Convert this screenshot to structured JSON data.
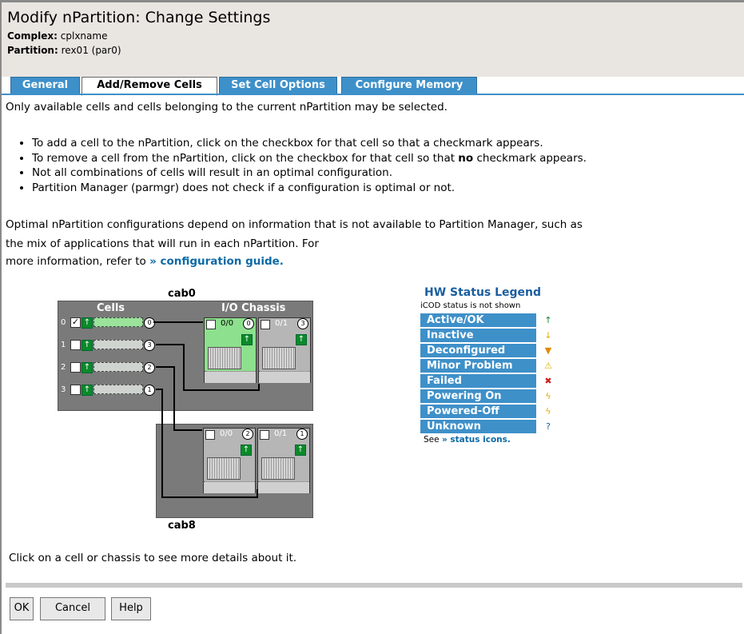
{
  "header": {
    "title": "Modify nPartition: Change Settings",
    "complex_label": "Complex:",
    "complex_value": "cplxname",
    "partition_label": "Partition:",
    "partition_value": "rex01 (par0)"
  },
  "tabs": [
    {
      "label": "General",
      "active": false
    },
    {
      "label": "Add/Remove Cells",
      "active": true
    },
    {
      "label": "Set Cell Options",
      "active": false
    },
    {
      "label": "Configure Memory",
      "active": false
    }
  ],
  "intro": "Only available cells and cells belonging to the current nPartition may be selected.",
  "bullets": {
    "b1": "To add a cell to the nPartition, click on the checkbox for that cell so that a checkmark appears.",
    "b2_pre": "To remove a cell from the nPartition, click on the checkbox for that cell so that ",
    "b2_bold": "no",
    "b2_post": " checkmark appears.",
    "b3": "Not all combinations of cells will result in an optimal configuration.",
    "b4": "Partition Manager (parmgr) does not check if a configuration is optimal or not."
  },
  "optimal": {
    "line1": "Optimal nPartition configurations depend on information that is not available to Partition Manager, such as",
    "line2": "the mix of applications that will run in each nPartition. For",
    "line3": "more information, refer to ",
    "link": "» configuration guide."
  },
  "diagram": {
    "cab0": "cab0",
    "cab8": "cab8",
    "cells_label": "Cells",
    "io_label": "I/O Chassis",
    "cells": [
      {
        "num": "0",
        "checked": true,
        "circle": "0",
        "check": "✓"
      },
      {
        "num": "1",
        "checked": false,
        "circle": "3",
        "check": ""
      },
      {
        "num": "2",
        "checked": false,
        "circle": "2",
        "check": ""
      },
      {
        "num": "3",
        "checked": false,
        "circle": "1",
        "check": ""
      }
    ],
    "chassis": {
      "c00": {
        "label": "0/0",
        "circle": "0"
      },
      "c01": {
        "label": "0/1",
        "circle": "3"
      },
      "c80": {
        "label": "0/0",
        "circle": "2"
      },
      "c81": {
        "label": "0/1",
        "circle": "1"
      }
    },
    "status_glyph": "↑"
  },
  "legend": {
    "title": "HW Status Legend",
    "subtitle": "iCOD status is not shown",
    "items": [
      {
        "name": "Active/OK",
        "icon": "↑",
        "icon_name": "active-ok-icon",
        "color": "#0b8a2a"
      },
      {
        "name": "Inactive",
        "icon": "↓",
        "icon_name": "inactive-icon",
        "color": "#e0b000"
      },
      {
        "name": "Deconfigured",
        "icon": "▼",
        "icon_name": "deconfigured-icon",
        "color": "#e08a00"
      },
      {
        "name": "Minor Problem",
        "icon": "⚠",
        "icon_name": "minor-problem-icon",
        "color": "#e0b000"
      },
      {
        "name": "Failed",
        "icon": "✖",
        "icon_name": "failed-icon",
        "color": "#d02020"
      },
      {
        "name": "Powering On",
        "icon": "ϟ",
        "icon_name": "powering-on-icon",
        "color": "#e0b000"
      },
      {
        "name": "Powered-Off",
        "icon": "ϟ",
        "icon_name": "powered-off-icon",
        "color": "#e0b000"
      },
      {
        "name": "Unknown",
        "icon": "?",
        "icon_name": "unknown-icon",
        "color": "#1a5ea0"
      }
    ],
    "see_pre": "See ",
    "see_link": "» status icons."
  },
  "footer_text": "Click on a cell or chassis to see more details about it.",
  "buttons": {
    "ok": "OK",
    "cancel": "Cancel",
    "help": "Help"
  }
}
